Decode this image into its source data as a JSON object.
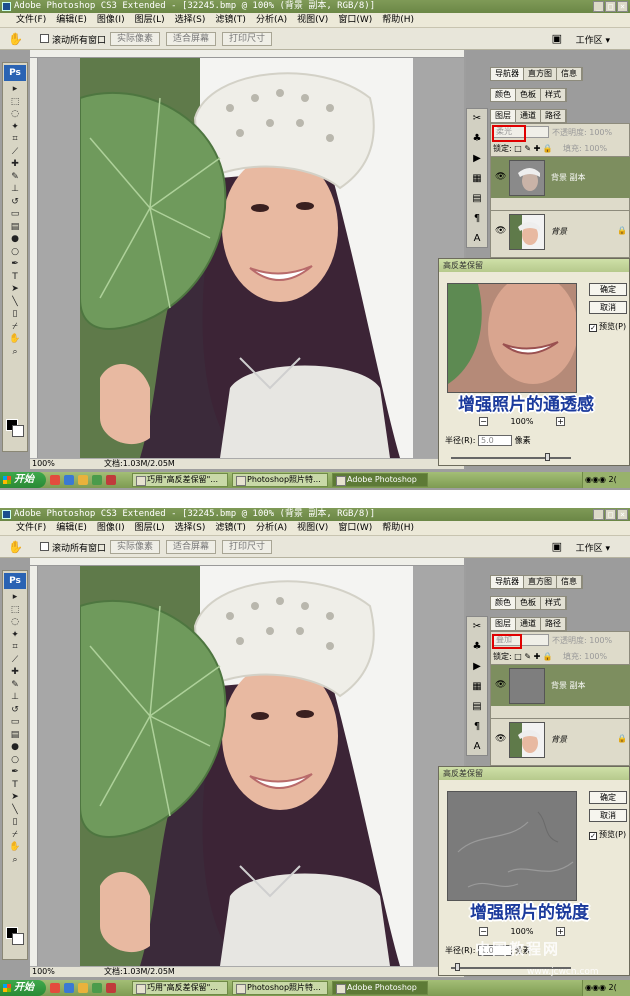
{
  "app": {
    "title": "Adobe Photoshop CS3 Extended - [32245.bmp @ 100% (背景 副本, RGB/8)]",
    "menu": [
      "文件(F)",
      "编辑(E)",
      "图像(I)",
      "图层(L)",
      "选择(S)",
      "滤镜(T)",
      "分析(A)",
      "视图(V)",
      "窗口(W)",
      "帮助(H)"
    ],
    "window_buttons": [
      "_",
      "□",
      "×"
    ],
    "options": {
      "scroll_all_label": "滚动所有窗口",
      "actual_pixels": "实际像素",
      "fit_screen": "适合屏幕",
      "print_size": "打印尺寸",
      "workspace": "工作区 ▾"
    },
    "toolbox_logo": "Ps"
  },
  "panels": {
    "row1_tabs": [
      "导航器",
      "直方图",
      "信息"
    ],
    "row2_tabs": [
      "颜色",
      "色板",
      "样式"
    ],
    "layers_tabs": [
      "图层",
      "通道",
      "路径"
    ],
    "opacity_label": "不透明度:",
    "opacity_value": "100%",
    "lock_label": "锁定:",
    "fill_label": "填充:",
    "fill_value": "100%",
    "layer_copy_name": "背景 副本",
    "layer_bg_name": "背景"
  },
  "dialog": {
    "title": "高反差保留",
    "ok": "确定",
    "cancel": "取消",
    "preview_label": "预览(P)",
    "zoom": "100%",
    "radius_label": "半径(R):",
    "unit": "像素"
  },
  "taskbar": {
    "start": "开始",
    "tasks": [
      "巧用\"高反差保留\"...",
      "Photoshop照片特...",
      "Adobe Photoshop"
    ]
  },
  "panel1": {
    "blend_mode": "柔光",
    "radius_value": "5.0",
    "callout": "增强照片的通透感",
    "status_zoom": "100%",
    "status_doc": "文档:1.03M/2.05M",
    "clock": "2("
  },
  "panel2": {
    "blend_mode": "叠加",
    "radius_value": "1.0",
    "callout": "增强照片的锐度",
    "status_zoom": "100%",
    "status_doc": "文档:1.03M/2.05M",
    "clock": "2("
  },
  "watermark": {
    "line1": "中国教程网",
    "line2": "www.jcwcn.com"
  },
  "colors": {
    "titlebar": "#6b8746",
    "selected_layer": "#7d8e5f",
    "callout": "#1b3a9c",
    "highlight_box": "#e00000"
  }
}
